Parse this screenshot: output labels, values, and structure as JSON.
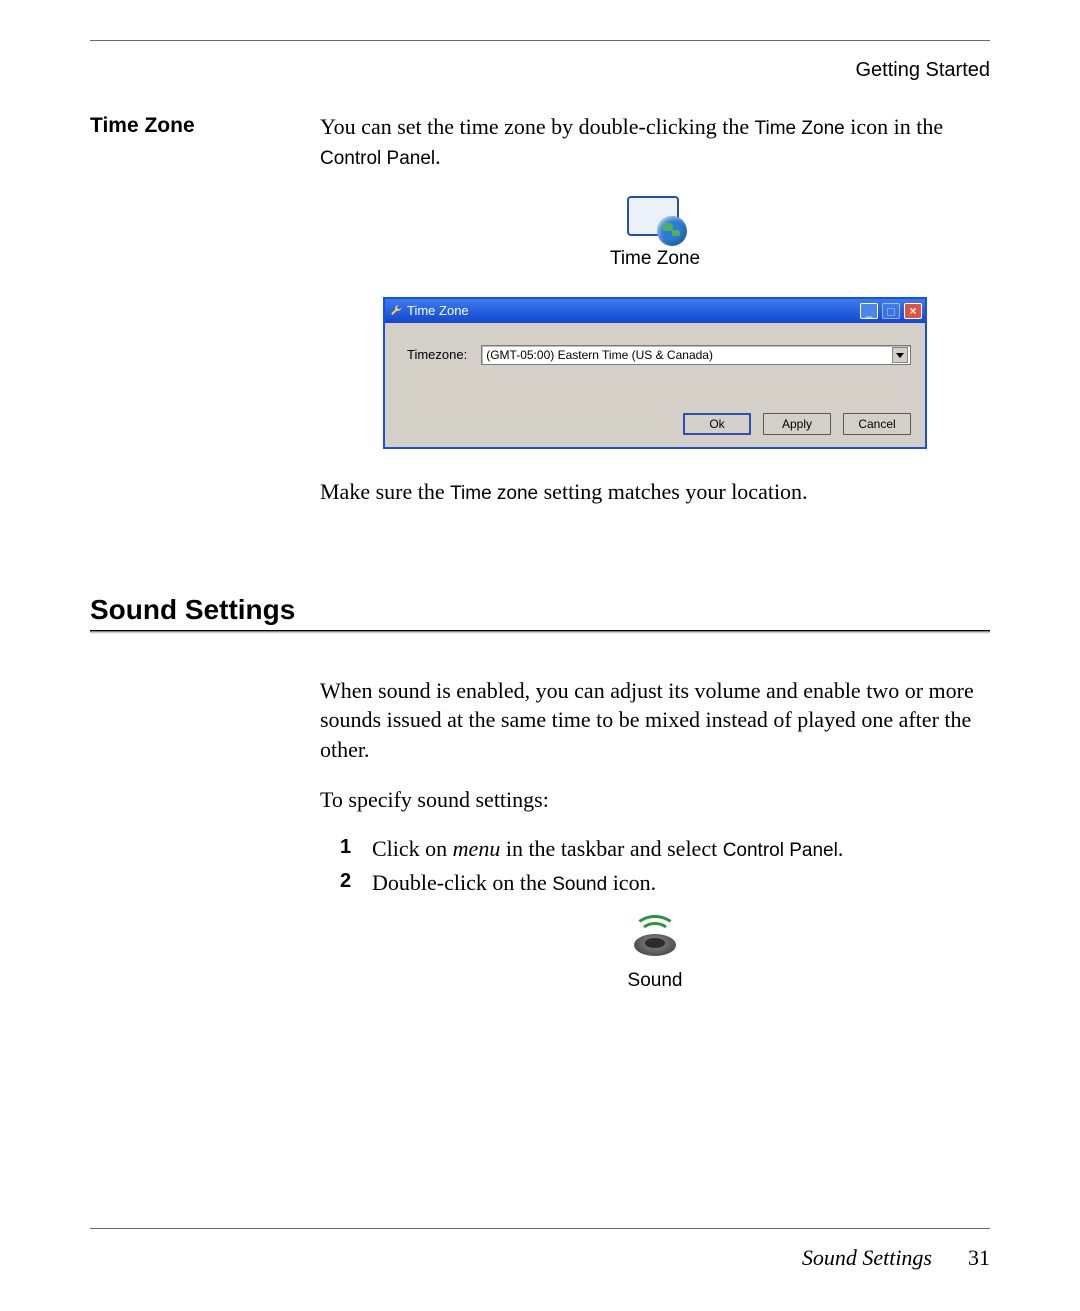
{
  "header": {
    "section": "Getting Started"
  },
  "tz": {
    "margin_head": "Time Zone",
    "intro_pre": "You can set the time zone by double-clicking the ",
    "intro_code1": "Time Zone",
    "intro_mid": " icon in the ",
    "intro_code2": "Control Panel",
    "intro_post": ".",
    "icon_label": "Time Zone",
    "window": {
      "title": "Time Zone",
      "field_label": "Timezone:",
      "selected": "(GMT-05:00) Eastern Time (US & Canada)",
      "buttons": {
        "ok": "Ok",
        "apply": "Apply",
        "cancel": "Cancel"
      }
    },
    "note_pre": "Make sure the ",
    "note_code": "Time zone",
    "note_post": " setting matches your location."
  },
  "sound": {
    "heading": "Sound Settings",
    "intro": "When sound is enabled, you can adjust its volume and enable two or more sounds issued at the same time to be mixed instead of played one after the other.",
    "lead": "To specify sound settings:",
    "steps": [
      {
        "n": "1",
        "pre": "Click on ",
        "em": "menu",
        "mid": " in the taskbar and select ",
        "code": "Control Panel",
        "post": "."
      },
      {
        "n": "2",
        "pre": "Double-click on the ",
        "code": "Sound",
        "post": " icon."
      }
    ],
    "icon_label": "Sound"
  },
  "footer": {
    "section": "Sound Settings",
    "page": "31"
  }
}
